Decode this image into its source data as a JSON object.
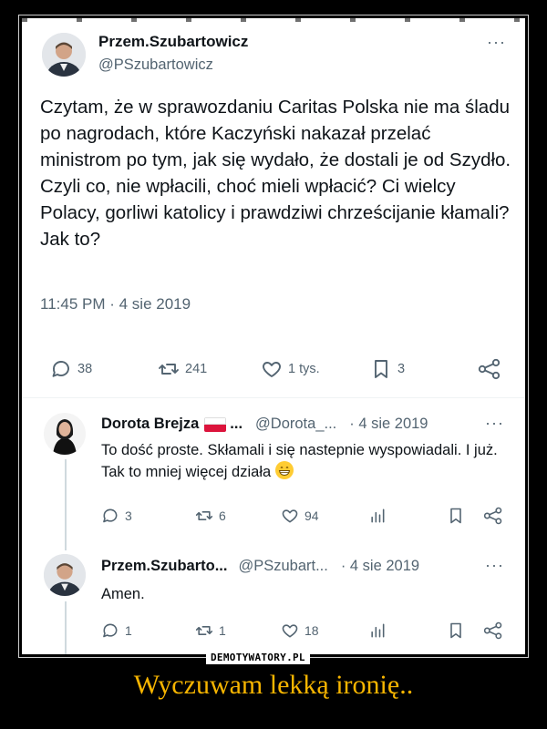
{
  "main_tweet": {
    "author_name": "Przem.Szubartowicz",
    "author_handle": "@PSzubartowicz",
    "more": "···",
    "text": "Czytam, że w sprawozdaniu Caritas Polska nie ma śladu po nagrodach, które Kaczyński nakazał przelać ministrom po tym, jak się wydało, że dostali je od Szydło. Czyli co, nie wpłacili, choć mieli wpłacić? Ci wielcy Polacy, gorliwi katolicy i prawdziwi chrześcijanie kłamali? Jak to?",
    "timestamp": "11:45 PM · 4 sie 2019",
    "replies": "38",
    "retweets": "241",
    "likes": "1 tys.",
    "bookmarks": "3"
  },
  "reply_1": {
    "author_name": "Dorota Brejza",
    "name_suffix": "...",
    "author_handle": "@Dorota_...",
    "date": "· 4 sie 2019",
    "more": "···",
    "text": "To dość proste. Skłamali i się nastepnie wyspowiadali. I już. Tak to mniej więcej działa",
    "replies": "3",
    "retweets": "6",
    "likes": "94"
  },
  "reply_2": {
    "author_name": "Przem.Szubarto...",
    "author_handle": "@PSzubart...",
    "date": "· 4 sie 2019",
    "more": "···",
    "text": "Amen.",
    "replies": "1",
    "retweets": "1",
    "likes": "18"
  },
  "watermark": "DEMOTYWATORY.PL",
  "caption": "Wyczuwam lekką ironię..",
  "colors": {
    "background": "#000000",
    "caption": "#f7b500",
    "icon_gray": "#536471",
    "flag_white": "#ffffff",
    "flag_red": "#dc143c"
  }
}
